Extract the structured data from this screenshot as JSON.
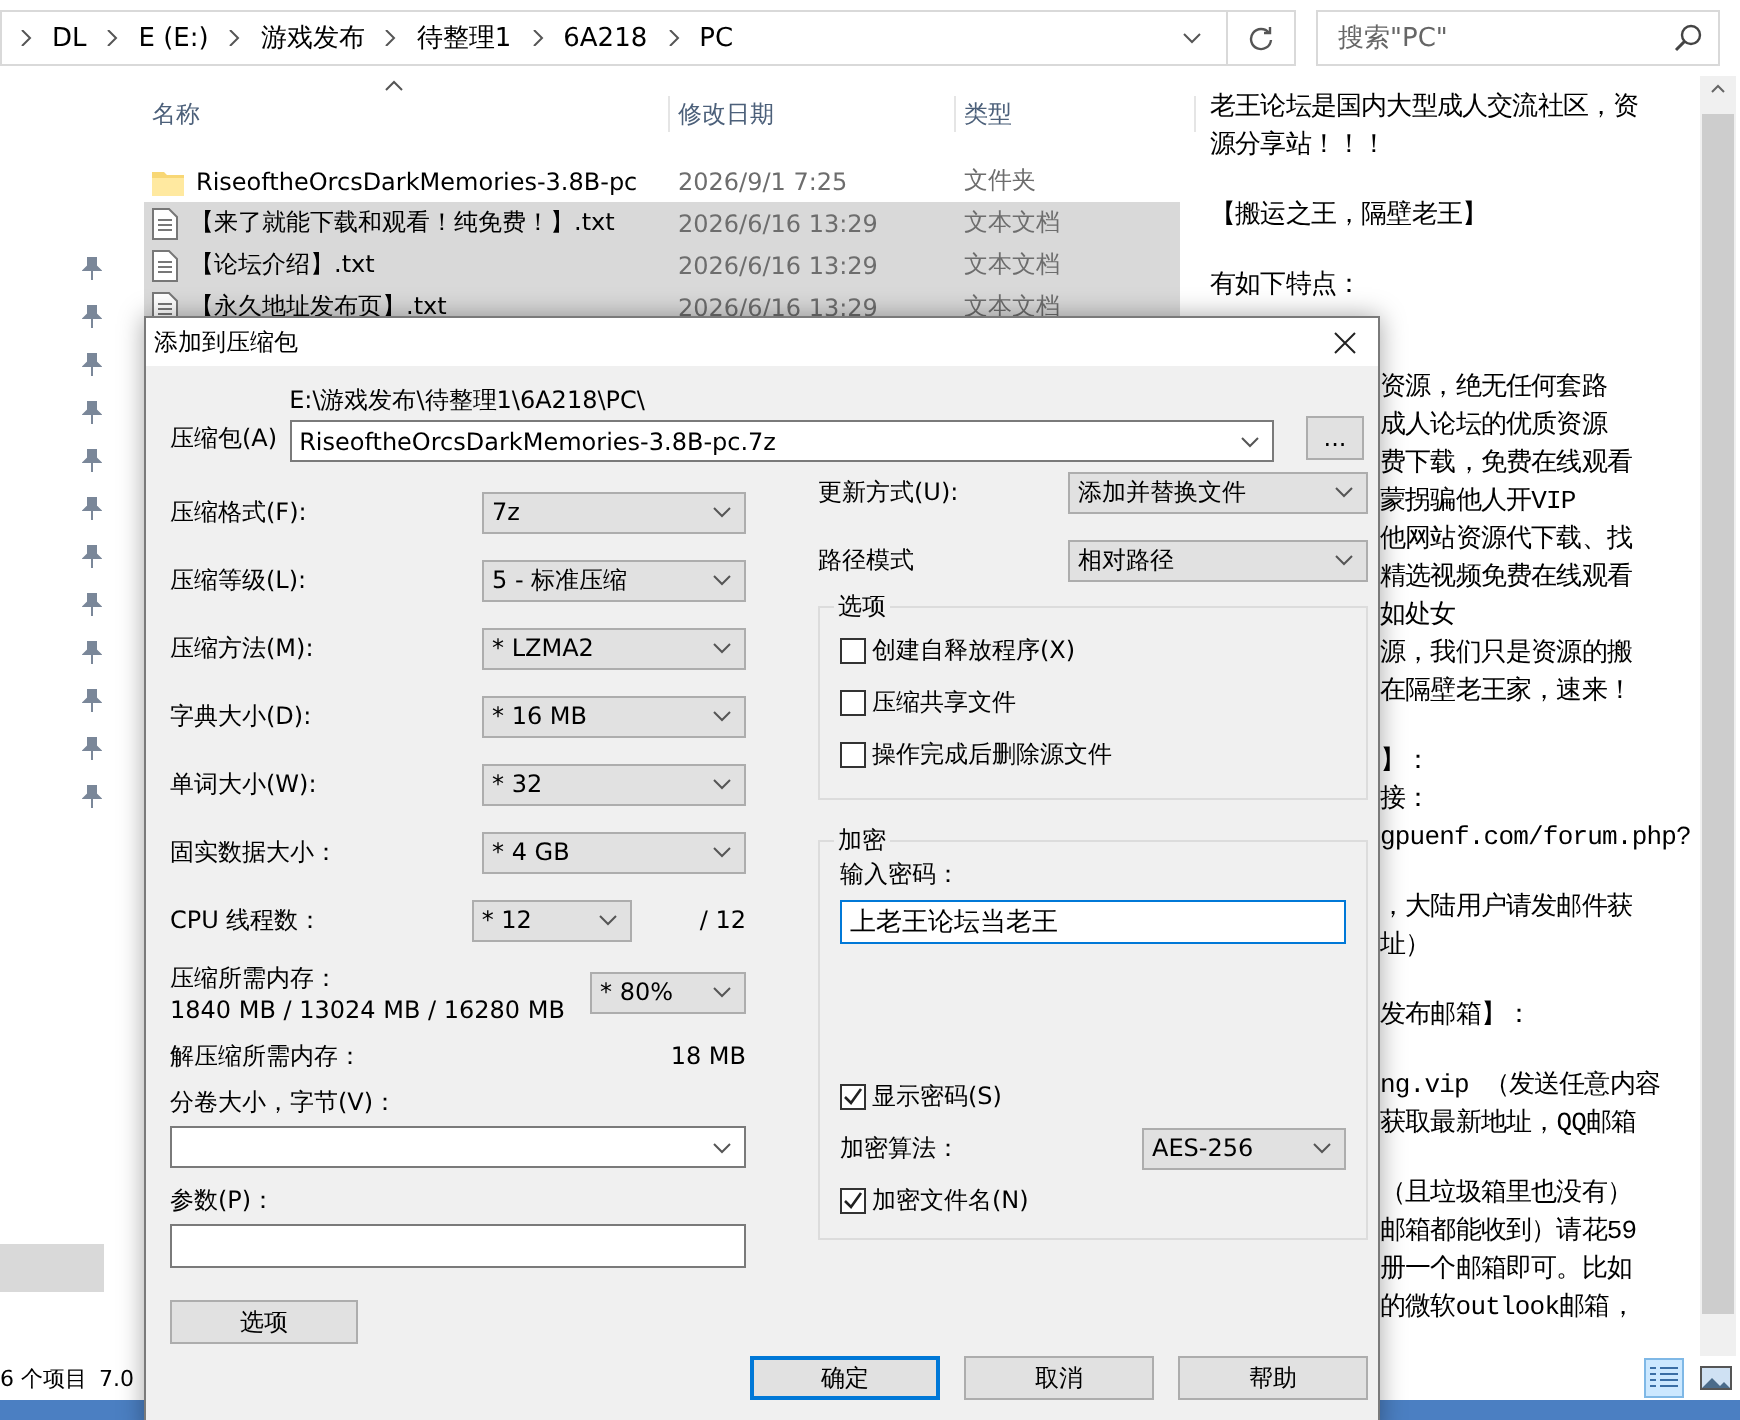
{
  "explorer": {
    "breadcrumbs": [
      "DL",
      "E (E:)",
      "游戏发布",
      "待整理1",
      "6A218",
      "PC"
    ],
    "search": {
      "placeholder": "搜索\"PC\""
    },
    "columns": [
      "名称",
      "修改日期",
      "类型"
    ],
    "files": [
      {
        "kind": "folder",
        "name": "RiseoftheOrcsDarkMemories-3.8B-pc",
        "modified": "2026/9/1 7:25",
        "type": "文件夹",
        "selected": false
      },
      {
        "kind": "text",
        "name": "【来了就能下载和观看！纯免费！】.txt",
        "modified": "2026/6/16 13:29",
        "type": "文本文档",
        "selected": true
      },
      {
        "kind": "text",
        "name": "【论坛介绍】.txt",
        "modified": "2026/6/16 13:29",
        "type": "文本文档",
        "selected": true
      },
      {
        "kind": "text",
        "name": "【永久地址发布页】.txt",
        "modified": "2026/6/16 13:29",
        "type": "文本文档",
        "selected": true
      }
    ],
    "status_bar": {
      "item_count": "6 个项目",
      "size": "7.0"
    }
  },
  "preview": {
    "paragraphs": [
      [
        "老王论坛是国内大型成人交流社区，资",
        "源分享站！！！"
      ],
      [
        "【搬运之王，隔壁老王】"
      ],
      [
        "有如下特点："
      ]
    ],
    "covered_paragraphs": [
      [
        "资源，绝无任何套路",
        "成人论坛的优质资源",
        "费下载，免费在线观看",
        "蒙拐骗他人开VIP",
        "他网站资源代下载、找",
        "精选视频免费在线观看",
        "如处女",
        "源，我们只是资源的搬",
        "在隔壁老王家，速来！"
      ],
      [
        "】：",
        "接：",
        "gpuenf.com/forum.php?"
      ],
      [
        "，大陆用户请发邮件获",
        "址）"
      ],
      [
        "发布邮箱】："
      ],
      [
        "ng.vip  （发送任意内容",
        "获取最新地址，QQ邮箱"
      ],
      [
        "（且垃圾箱里也没有）",
        "邮箱都能收到）请花59",
        "册一个邮箱即可。比如",
        "的微软outlook邮箱，"
      ]
    ]
  },
  "dialog": {
    "title": "添加到压缩包",
    "archive": {
      "label": "压缩包(A)",
      "folder": "E:\\游戏发布\\待整理1\\6A218\\PC\\",
      "value": "RiseoftheOrcsDarkMemories-3.8B-pc.7z",
      "browse": "..."
    },
    "settings": [
      {
        "label": "压缩格式(F):",
        "value": "7z"
      },
      {
        "label": "压缩等级(L):",
        "value": "5 - 标准压缩"
      },
      {
        "label": "压缩方法(M):",
        "value": "* LZMA2"
      },
      {
        "label": "字典大小(D):",
        "value": "* 16 MB"
      },
      {
        "label": "单词大小(W):",
        "value": "* 32"
      },
      {
        "label": "固实数据大小：",
        "value": "* 4 GB"
      }
    ],
    "threads": {
      "label": "CPU 线程数：",
      "value": "* 12",
      "max": "/ 12"
    },
    "memory": {
      "label": "压缩所需内存：",
      "detail": "1840 MB / 13024 MB / 16280 MB",
      "value": "* 80%"
    },
    "decompress_memory": {
      "label": "解压缩所需内存：",
      "value": "18 MB"
    },
    "split": {
      "label": "分卷大小，字节(V)："
    },
    "params": {
      "label": "参数(P)："
    },
    "options_button": "选项",
    "update_mode": {
      "label": "更新方式(U):",
      "value": "添加并替换文件"
    },
    "path_mode": {
      "label": "路径模式",
      "value": "相对路径"
    },
    "options": {
      "title": "选项",
      "items": [
        {
          "label": "创建自释放程序(X)",
          "checked": false
        },
        {
          "label": "压缩共享文件",
          "checked": false
        },
        {
          "label": "操作完成后删除源文件",
          "checked": false
        }
      ]
    },
    "encryption": {
      "title": "加密",
      "password_label": "输入密码：",
      "password": "上老王论坛当老王",
      "show_password": {
        "label": "显示密码(S)",
        "checked": true
      },
      "method": {
        "label": "加密算法：",
        "value": "AES-256"
      },
      "encrypt_names": {
        "label": "加密文件名(N)",
        "checked": true
      }
    },
    "buttons": [
      {
        "label": "确定",
        "default": true
      },
      {
        "label": "取消",
        "default": false
      },
      {
        "label": "帮助",
        "default": false
      }
    ]
  }
}
